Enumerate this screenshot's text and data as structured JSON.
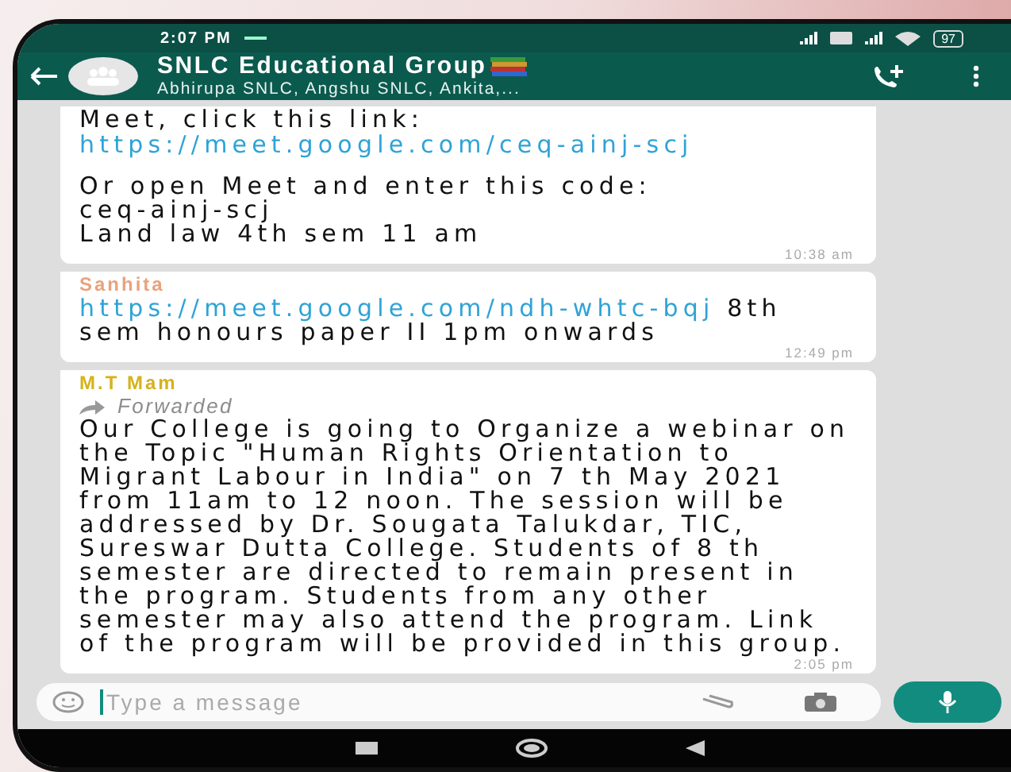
{
  "status_bar": {
    "time": "2:07 PM",
    "battery": "97"
  },
  "header": {
    "title": "SNLC Educational Group",
    "subtitle": "Abhirupa SNLC, Angshu SNLC, Ankita,..."
  },
  "messages": [
    {
      "forwarded": false,
      "parts": [
        {
          "kind": "text",
          "text": "Meet, click this link:"
        },
        {
          "kind": "link",
          "text": "https://meet.google.com/ceq-ainj-scj"
        },
        {
          "kind": "gap"
        },
        {
          "kind": "text",
          "text": "Or open Meet and enter this code:"
        },
        {
          "kind": "text",
          "text": "ceq-ainj-scj"
        },
        {
          "kind": "text",
          "text": "Land law 4th sem 11 am"
        }
      ],
      "time": "10:38 am"
    },
    {
      "sender": {
        "name": "Sanhita",
        "color": "#e9a27c"
      },
      "forwarded": false,
      "parts": [
        {
          "kind": "link_text",
          "link": "https://meet.google.com/ndh-whtc-bqj",
          "text": "8th sem honours paper II 1pm onwards"
        }
      ],
      "time": "12:49 pm"
    },
    {
      "sender": {
        "name": "M.T  Mam",
        "color": "#d6b21c"
      },
      "forwarded": true,
      "forwarded_label": "Forwarded",
      "parts": [
        {
          "kind": "text",
          "text": "Our College is going to Organize a webinar on the Topic \"Human Rights Orientation to Migrant Labour in India\" on 7 th May 2021 from 11am to 12 noon. The session will be addressed by Dr. Sougata Talukdar, TIC, Sureswar Dutta College. Students of 8 th semester are directed to remain present in the program. Students from any other semester may also attend the program. Link of the program will be provided in this group."
        }
      ],
      "time": "2:05 pm"
    }
  ],
  "composer": {
    "placeholder": "Type a message"
  }
}
